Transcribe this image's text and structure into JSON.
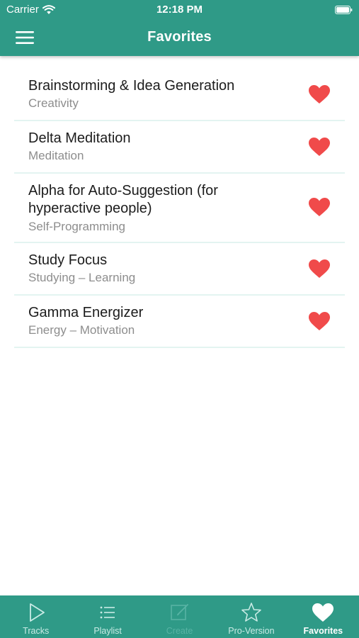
{
  "status_bar": {
    "carrier": "Carrier",
    "time": "12:18 PM"
  },
  "nav": {
    "title": "Favorites",
    "menu_icon": "hamburger-menu-icon"
  },
  "favorites": [
    {
      "title": "Brainstorming & Idea Generation",
      "category": "Creativity"
    },
    {
      "title": "Delta Meditation",
      "category": "Meditation"
    },
    {
      "title": "Alpha for Auto-Suggestion (for hyperactive people)",
      "category": "Self-Programming"
    },
    {
      "title": "Study Focus",
      "category": "Studying – Learning"
    },
    {
      "title": "Gamma Energizer",
      "category": "Energy – Motivation"
    }
  ],
  "tabs": [
    {
      "label": "Tracks",
      "icon": "play-icon"
    },
    {
      "label": "Playlist",
      "icon": "list-icon"
    },
    {
      "label": "Create",
      "icon": "edit-icon",
      "disabled": true
    },
    {
      "label": "Pro-Version",
      "icon": "star-icon"
    },
    {
      "label": "Favorites",
      "icon": "heart-icon",
      "active": true
    }
  ],
  "colors": {
    "primary": "#2f9a87",
    "heart": "#f04a4a",
    "title_text": "#1c1c1c",
    "subtitle_text": "#8d8d8d",
    "separator": "#e3f4f1"
  }
}
